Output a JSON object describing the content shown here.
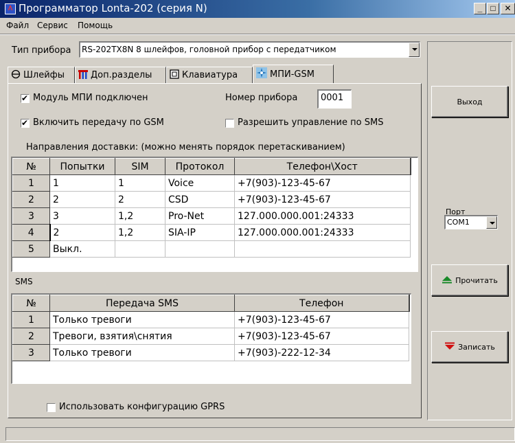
{
  "window": {
    "title": "Программатор Lonta-202 (серия N)",
    "title_bar_gradient_colors": [
      "#0a246a",
      "#a6caf0"
    ],
    "icon": "app-logo-icon",
    "controls": [
      "minimize-icon",
      "maximize-icon",
      "close-icon"
    ]
  },
  "menu": {
    "items": [
      {
        "label": "Файл"
      },
      {
        "label": "Сервис"
      },
      {
        "label": "Помощь"
      }
    ]
  },
  "device": {
    "label": "Тип прибора",
    "value": "RS-202TX8N 8 шлейфов, головной прибор с передатчиком"
  },
  "tabs": [
    {
      "label": "Шлейфы",
      "icon": "loops-icon"
    },
    {
      "label": "Доп.разделы",
      "icon": "sections-icon"
    },
    {
      "label": "Клавиатура",
      "icon": "keyboard-icon"
    },
    {
      "label": "МПИ-GSM",
      "icon": "gsm-icon",
      "active": true
    }
  ],
  "mpi": {
    "module_connected": {
      "label": "Модуль МПИ подключен",
      "checked": true
    },
    "device_number": {
      "label": "Номер прибора",
      "value": "0001"
    },
    "gsm_transfer": {
      "label": "Включить передачу по GSM",
      "checked": true
    },
    "sms_control": {
      "label": "Разрешить управление по SMS",
      "checked": false
    },
    "directions_caption": "Направления доставки: (можно менять порядок перетаскиванием)",
    "directions": {
      "headers": [
        "№",
        "Попытки",
        "SIM",
        "Протокол",
        "Телефон\\Хост"
      ],
      "rows": [
        [
          "1",
          "1",
          "1",
          "Voice",
          "+7(903)-123-45-67"
        ],
        [
          "2",
          "2",
          "2",
          "CSD",
          "+7(903)-123-45-67"
        ],
        [
          "3",
          "3",
          "1,2",
          "Pro-Net",
          "127.000.000.001:24333"
        ],
        [
          "4",
          "2",
          "1,2",
          "SIA-IP",
          "127.000.000.001:24333"
        ],
        [
          "5",
          "Выкл.",
          "",
          "",
          ""
        ]
      ]
    },
    "sms_caption": "SMS",
    "sms": {
      "headers": [
        "№",
        "Передача SMS",
        "Телефон"
      ],
      "rows": [
        [
          "1",
          "Только тревоги",
          "+7(903)-123-45-67"
        ],
        [
          "2",
          "Тревоги, взятия\\снятия",
          "+7(903)-123-45-67"
        ],
        [
          "3",
          "Только тревоги",
          "+7(903)-222-12-34"
        ]
      ]
    },
    "gprs": {
      "label": "Использовать конфигурацию GPRS",
      "checked": false
    }
  },
  "side": {
    "exit_label": "Выход",
    "port_label": "Порт",
    "port_value": "COM1",
    "read_label": "Прочитать",
    "read_icon": "up-triangle-icon",
    "read_icon_color": "#1a8a2a",
    "write_label": "Записать",
    "write_icon": "down-triangle-icon",
    "write_icon_color": "#d01010"
  }
}
